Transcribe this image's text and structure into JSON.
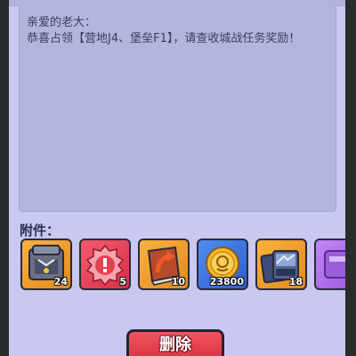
{
  "mail": {
    "greeting": "亲爱的老大：",
    "body": "恭喜占领【营地J4、堡垒F1】，请查收城战任务奖励！"
  },
  "attachments": {
    "label": "附件：",
    "items": [
      {
        "icon": "armor-chest-icon",
        "quantity": "24",
        "rarity_color": "#f0a030"
      },
      {
        "icon": "gear-badge-icon",
        "quantity": "5",
        "rarity_color": "#e8404f"
      },
      {
        "icon": "upgrade-book-icon",
        "quantity": "10",
        "rarity_color": "#f0a030"
      },
      {
        "icon": "gold-coin-icon",
        "quantity": "23800",
        "rarity_color": "#3b74e0"
      },
      {
        "icon": "card-pack-icon",
        "quantity": "18",
        "rarity_color": "#f0a030"
      },
      {
        "icon": "purple-item-icon",
        "quantity": "",
        "rarity_color": "#b070f0"
      }
    ]
  },
  "actions": {
    "delete_label": "删除",
    "delete_color": "#e8404f"
  }
}
